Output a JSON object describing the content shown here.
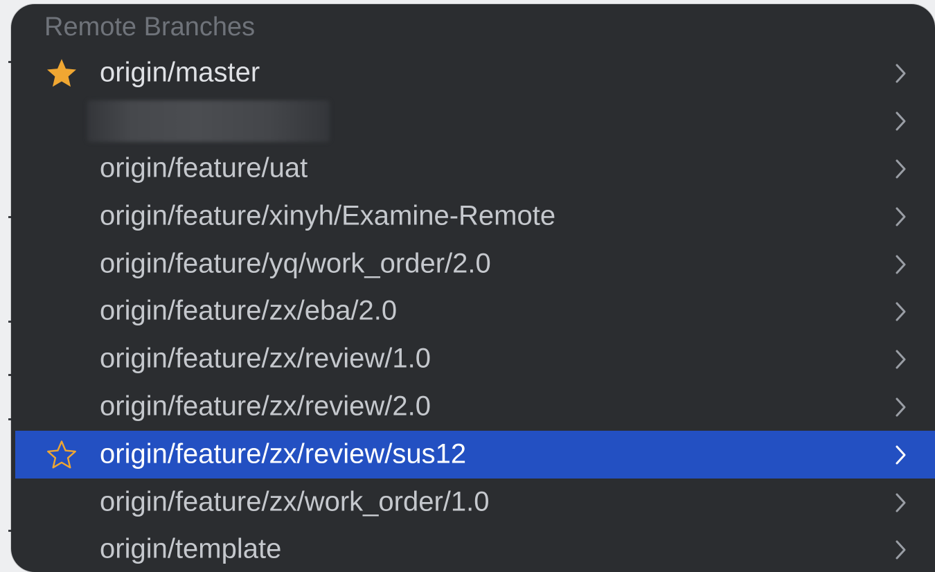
{
  "section": {
    "title": "Remote Branches"
  },
  "colors": {
    "background": "#2b2d30",
    "selection": "#2350c2",
    "star": "#f0a732",
    "text": "#c5c8cd",
    "header": "#6f737a",
    "chevron": "#9a9ea5"
  },
  "branches": [
    {
      "label": "origin/master",
      "star": "filled-star-icon",
      "selected": false,
      "blurred": false
    },
    {
      "label": "",
      "star": "none",
      "selected": false,
      "blurred": true
    },
    {
      "label": "origin/feature/uat",
      "star": "none",
      "selected": false,
      "blurred": false
    },
    {
      "label": "origin/feature/xinyh/Examine-Remote",
      "star": "none",
      "selected": false,
      "blurred": false
    },
    {
      "label": "origin/feature/yq/work_order/2.0",
      "star": "none",
      "selected": false,
      "blurred": false
    },
    {
      "label": "origin/feature/zx/eba/2.0",
      "star": "none",
      "selected": false,
      "blurred": false
    },
    {
      "label": "origin/feature/zx/review/1.0",
      "star": "none",
      "selected": false,
      "blurred": false
    },
    {
      "label": "origin/feature/zx/review/2.0",
      "star": "none",
      "selected": false,
      "blurred": false
    },
    {
      "label": "origin/feature/zx/review/sus12",
      "star": "outline-star-icon",
      "selected": true,
      "blurred": false
    },
    {
      "label": "origin/feature/zx/work_order/1.0",
      "star": "none",
      "selected": false,
      "blurred": false
    },
    {
      "label": "origin/template",
      "star": "none",
      "selected": false,
      "blurred": false
    }
  ],
  "icons": {
    "chevron": "chevron-right-icon"
  }
}
